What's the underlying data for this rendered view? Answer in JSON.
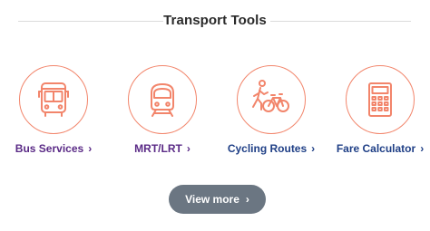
{
  "section": {
    "title": "Transport Tools"
  },
  "tools": [
    {
      "label": "Bus Services",
      "icon": "bus-icon"
    },
    {
      "label": "MRT/LRT",
      "icon": "train-icon"
    },
    {
      "label": "Cycling Routes",
      "icon": "cycling-icon"
    },
    {
      "label": "Fare Calculator",
      "icon": "calculator-icon"
    }
  ],
  "chevron": "›",
  "view_more": {
    "label": "View more"
  },
  "colors": {
    "icon_stroke": "#f2856b",
    "label_purple": "#5a2a86",
    "label_blue": "#1f3f86",
    "button_bg": "#6b7682"
  }
}
